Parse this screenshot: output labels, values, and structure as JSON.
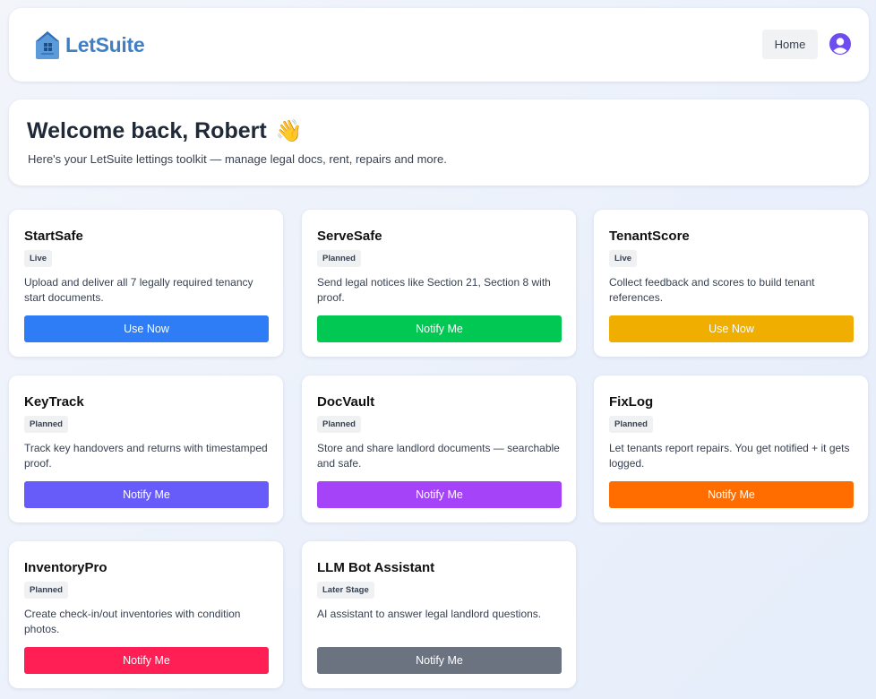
{
  "header": {
    "logo_text": "LetSuite",
    "home_label": "Home",
    "logo_color": "#3f7fc4"
  },
  "welcome": {
    "title": "Welcome back, Robert",
    "wave_emoji": "👋",
    "subtitle": "Here's your LetSuite lettings toolkit — manage legal docs, rent, repairs and more."
  },
  "cards": [
    {
      "title": "StartSafe",
      "status": "Live",
      "description": "Upload and deliver all 7 legally required tenancy start documents.",
      "button": "Use Now",
      "color": "#2f7df6"
    },
    {
      "title": "ServeSafe",
      "status": "Planned",
      "description": "Send legal notices like Section 21, Section 8 with proof.",
      "button": "Notify Me",
      "color": "#00c853"
    },
    {
      "title": "TenantScore",
      "status": "Live",
      "description": "Collect feedback and scores to build tenant references.",
      "button": "Use Now",
      "color": "#f0ae00"
    },
    {
      "title": "KeyTrack",
      "status": "Planned",
      "description": "Track key handovers and returns with timestamped proof.",
      "button": "Notify Me",
      "color": "#675cf9"
    },
    {
      "title": "DocVault",
      "status": "Planned",
      "description": "Store and share landlord documents — searchable and safe.",
      "button": "Notify Me",
      "color": "#a443f7"
    },
    {
      "title": "FixLog",
      "status": "Planned",
      "description": "Let tenants report repairs. You get notified + it gets logged.",
      "button": "Notify Me",
      "color": "#ff6d00"
    },
    {
      "title": "InventoryPro",
      "status": "Planned",
      "description": "Create check-in/out inventories with condition photos.",
      "button": "Notify Me",
      "color": "#ff1f55"
    },
    {
      "title": "LLM Bot Assistant",
      "status": "Later Stage",
      "description": "AI assistant to answer legal landlord questions.",
      "button": "Notify Me",
      "color": "#6b7280"
    }
  ]
}
